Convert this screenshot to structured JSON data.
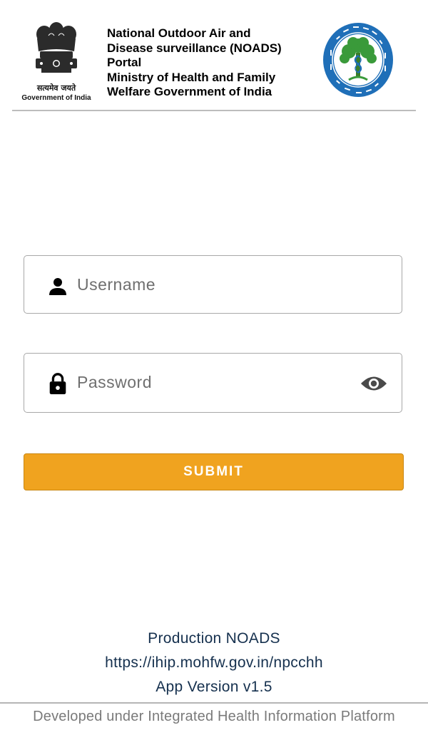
{
  "header": {
    "emblem_motto": "सत्यमेव जयते",
    "emblem_caption": "Government of India",
    "title_lines": [
      "National Outdoor Air and",
      "Disease surveillance (NOADS)",
      "Portal",
      "Ministry of Health and Family",
      "Welfare Government of India"
    ]
  },
  "login": {
    "username_placeholder": "Username",
    "password_placeholder": "Password",
    "submit_label": "SUBMIT",
    "icons": {
      "username": "person-icon",
      "password": "lock-icon",
      "visibility": "eye-icon"
    }
  },
  "info": {
    "environment": "Production NOADS",
    "url": "https://ihip.mohfw.gov.in/npcchh",
    "version": "App Version v1.5"
  },
  "footer": {
    "text": "Developed under Integrated Health Information Platform"
  },
  "colors": {
    "submit": "#f0a31f",
    "info_text": "#15304e",
    "seal_blue": "#1f6fb8",
    "seal_green": "#3a9a3a"
  }
}
